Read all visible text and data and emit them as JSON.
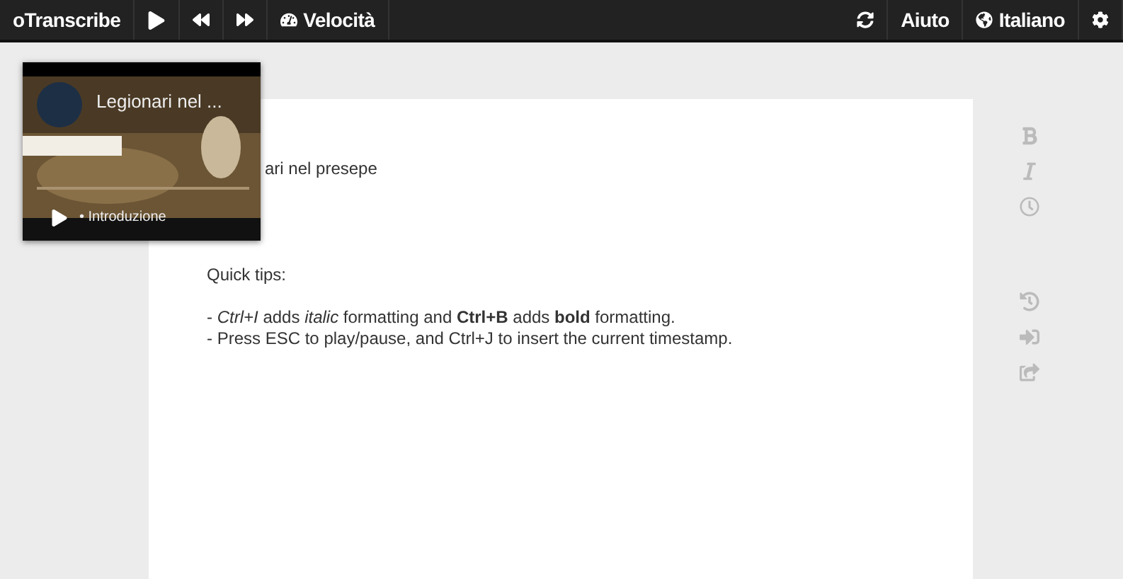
{
  "navbar": {
    "brand": "oTranscribe",
    "left_buttons": [
      {
        "kind": "play"
      },
      {
        "kind": "rewind"
      },
      {
        "kind": "forward"
      },
      {
        "kind": "speed",
        "label": "Velocità"
      }
    ],
    "right_buttons": [
      {
        "kind": "sync"
      },
      {
        "kind": "text",
        "label": "Aiuto"
      },
      {
        "kind": "language",
        "label": "Italiano"
      },
      {
        "kind": "settings"
      }
    ]
  },
  "video": {
    "title": "Legionari nel ...",
    "chapter": "• Introduzione"
  },
  "document": {
    "title_fragment": "ari nel presepe",
    "tips_heading": "Quick tips:",
    "tips": [
      "- *Ctrl+I* adds *italic* formatting and **Ctrl+B** adds **bold** formatting.",
      "- Press ESC to play/pause, and Ctrl+J to insert the current timestamp."
    ]
  },
  "side_tools": [
    {
      "kind": "bold"
    },
    {
      "kind": "italic"
    },
    {
      "kind": "timestamp"
    },
    {
      "kind": "gap"
    },
    {
      "kind": "history"
    },
    {
      "kind": "import"
    },
    {
      "kind": "export"
    }
  ]
}
